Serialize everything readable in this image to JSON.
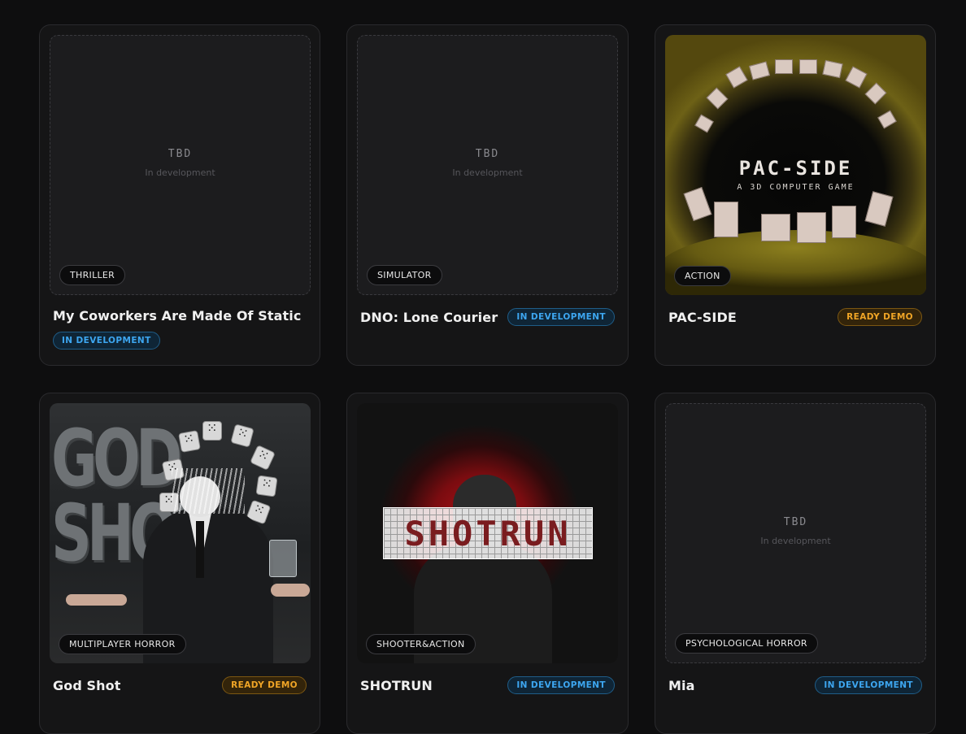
{
  "games": [
    {
      "title": "My Coworkers Are Made Of Static",
      "genre": "THRILLER",
      "status": "IN DEVELOPMENT",
      "status_type": "dev",
      "placeholder": {
        "title": "TBD",
        "subtitle": "In development"
      }
    },
    {
      "title": "DNO: Lone Courier",
      "genre": "SIMULATOR",
      "status": "IN DEVELOPMENT",
      "status_type": "dev",
      "placeholder": {
        "title": "TBD",
        "subtitle": "In development"
      }
    },
    {
      "title": "PAC-SIDE",
      "genre": "ACTION",
      "status": "READY DEMO",
      "status_type": "demo",
      "art": {
        "title": "PAC-SIDE",
        "subtitle": "A 3D COMPUTER GAME"
      }
    },
    {
      "title": "God Shot",
      "genre": "MULTIPLAYER HORROR",
      "status": "READY DEMO",
      "status_type": "demo",
      "art": {
        "title": "GOD SHOT"
      }
    },
    {
      "title": "SHOTRUN",
      "genre": "SHOOTER&ACTION",
      "status": "IN DEVELOPMENT",
      "status_type": "dev",
      "art": {
        "title": "SHOTRUN"
      }
    },
    {
      "title": "Mia",
      "genre": "PSYCHOLOGICAL HORROR",
      "status": "IN DEVELOPMENT",
      "status_type": "dev",
      "placeholder": {
        "title": "TBD",
        "subtitle": "In development"
      }
    }
  ],
  "colors": {
    "background": "#0e0e0f",
    "card": "#151516",
    "dev_badge": "#3da6f0",
    "demo_badge": "#f0a526"
  }
}
